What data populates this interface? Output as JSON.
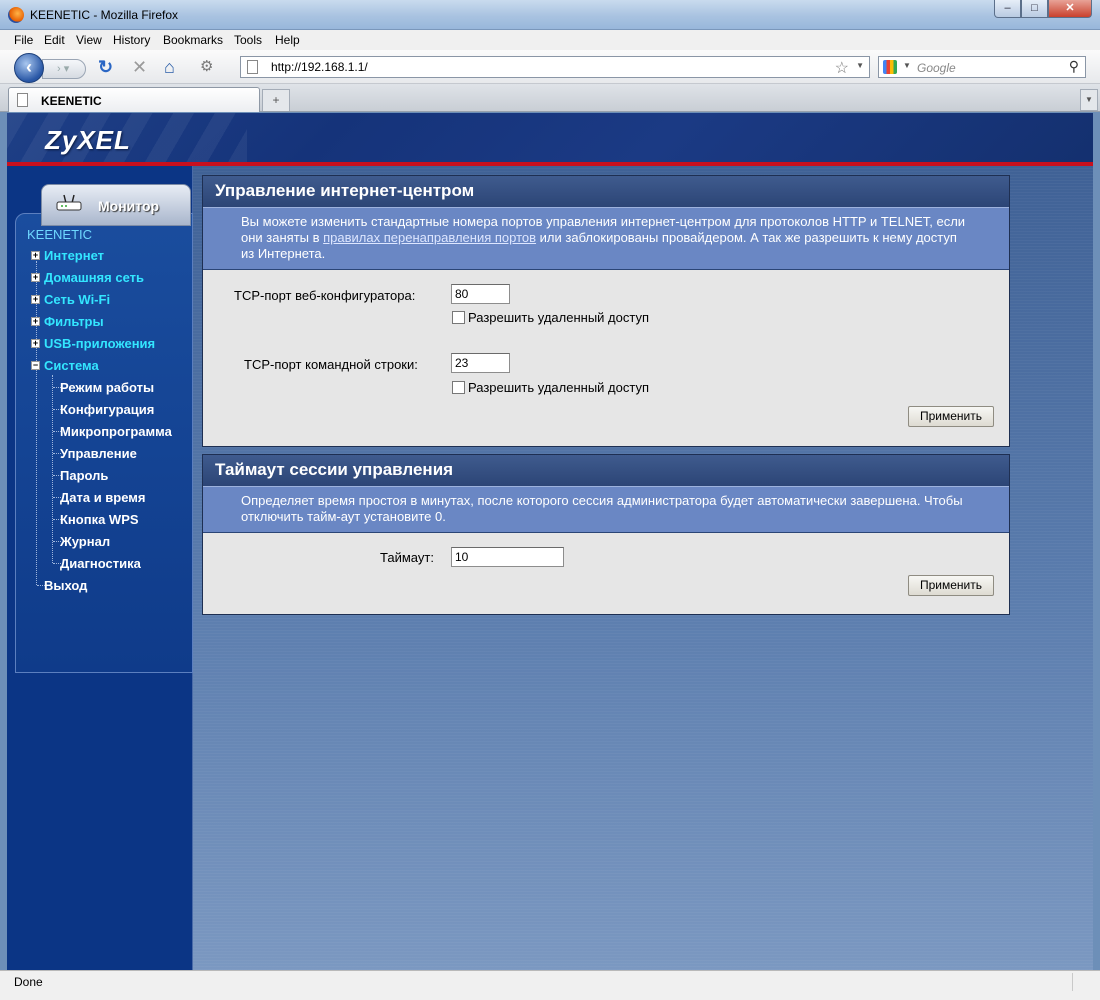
{
  "window": {
    "title": "KEENETIC - Mozilla Firefox",
    "min": "–",
    "max": "□",
    "close": "✕"
  },
  "menubar": [
    "File",
    "Edit",
    "View",
    "History",
    "Bookmarks",
    "Tools",
    "Help"
  ],
  "nav": {
    "back": "‹",
    "forward": "›",
    "reload": "↻",
    "stop": "✕",
    "home": "⌂",
    "addons": "⚙",
    "url": "http://192.168.1.1/",
    "search_placeholder": "Google"
  },
  "tab": {
    "label": "KEENETIC",
    "new_tab": "+"
  },
  "brand": {
    "logo": "ZyXEL"
  },
  "sidebar": {
    "monitor_label": "Монитор",
    "root": "KEENETIC",
    "top_items": [
      "Интернет",
      "Домашняя сеть",
      "Сеть Wi-Fi",
      "Фильтры",
      "USB-приложения",
      "Система"
    ],
    "sub_items": [
      "Режим работы",
      "Конфигурация",
      "Микропрограмма",
      "Управление",
      "Пароль",
      "Дата и время",
      "Кнопка WPS",
      "Журнал",
      "Диагностика"
    ],
    "exit": "Выход"
  },
  "panel1": {
    "title": "Управление интернет-центром",
    "desc_1": "Вы можете изменить стандартные номера портов управления интернет-центром для протоколов HTTP и TELNET, если они заняты в ",
    "desc_link": "правилах перенаправления портов",
    "desc_2": " или заблокированы провайдером. А так же разрешить к нему доступ из Интернета.",
    "web_port_label": "TCP-порт веб-конфигуратора:",
    "web_port_value": "80",
    "web_remote_label": "Разрешить удаленный доступ",
    "cli_port_label": "TCP-порт командной строки:",
    "cli_port_value": "23",
    "cli_remote_label": "Разрешить удаленный доступ",
    "apply": "Применить"
  },
  "panel2": {
    "title": "Таймаут сессии управления",
    "desc": "Определяет время простоя в минутах, после которого сессия администратора будет автоматически завершена. Чтобы отключить тайм-аут установите 0.",
    "timeout_label": "Таймаут:",
    "timeout_value": "10",
    "apply": "Применить"
  },
  "status": {
    "text": "Done"
  },
  "colors": {
    "accent_red": "#c8101e",
    "sidebar": "#0b3585",
    "menu_top": "#33e6ff",
    "panel_desc": "#6a87c4"
  }
}
